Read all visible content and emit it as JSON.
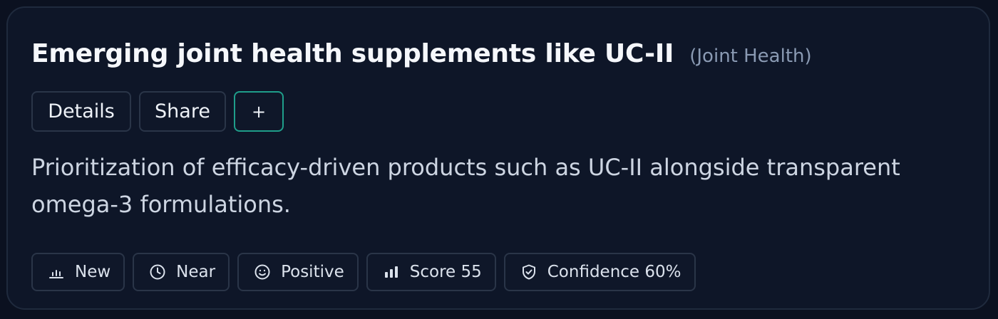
{
  "insight": {
    "title": "Emerging joint health supplements like UC-II",
    "category": "(Joint Health)",
    "description": "Prioritization of efficacy-driven products such as UC-II alongside transparent omega-3 formulations."
  },
  "actions": {
    "details_label": "Details",
    "share_label": "Share",
    "add_label": "+"
  },
  "tags": [
    {
      "icon": "bar-chart-icon",
      "label": "New"
    },
    {
      "icon": "clock-icon",
      "label": "Near"
    },
    {
      "icon": "smile-icon",
      "label": "Positive"
    },
    {
      "icon": "score-bars-icon",
      "label": "Score 55"
    },
    {
      "icon": "shield-check-icon",
      "label": "Confidence 60%"
    }
  ],
  "colors": {
    "page_background": "#0b1120",
    "card_background": "#0e1628",
    "accent_border": "#1f9e8a",
    "title_text": "#f5f7fb",
    "muted_text": "#8a9ab3"
  }
}
